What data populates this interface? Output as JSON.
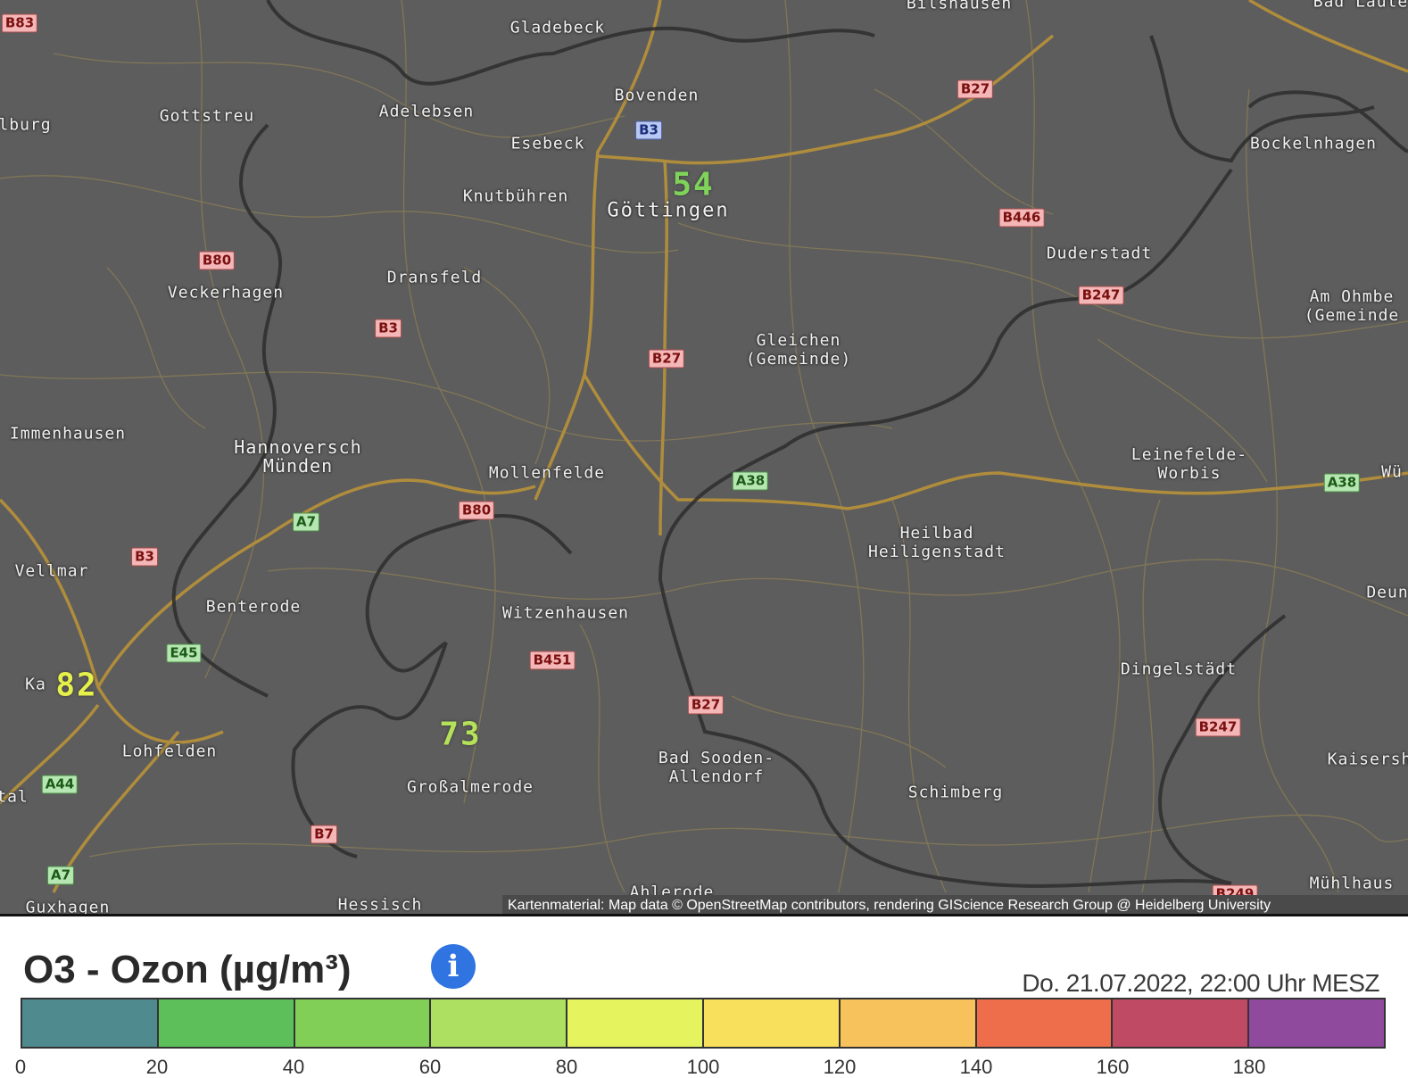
{
  "map": {
    "places": [
      {
        "id": "gladebeck",
        "name": "Gladebeck"
      },
      {
        "id": "bilshausen",
        "name": "Bilshausen"
      },
      {
        "id": "bad-lauter",
        "name": "Bad Laute"
      },
      {
        "id": "bovenden",
        "name": "Bovenden"
      },
      {
        "id": "burg",
        "name": "lburg"
      },
      {
        "id": "gottstreu",
        "name": "Gottstreu"
      },
      {
        "id": "adelebsen",
        "name": "Adelebsen"
      },
      {
        "id": "esebeck",
        "name": "Esebeck"
      },
      {
        "id": "bockelnhagen",
        "name": "Bockelnhagen"
      },
      {
        "id": "knutbuehren",
        "name": "Knutbühren"
      },
      {
        "id": "goettingen",
        "name": "Göttingen"
      },
      {
        "id": "duderstadt",
        "name": "Duderstadt"
      },
      {
        "id": "veckerhagen",
        "name": "Veckerhagen"
      },
      {
        "id": "dransfeld",
        "name": "Dransfeld"
      },
      {
        "id": "am-ohmberg",
        "name": "Am Ohmbe\n(Gemeinde"
      },
      {
        "id": "gleichen",
        "name": "Gleichen\n(Gemeinde)"
      },
      {
        "id": "immenhausen",
        "name": "Immenhausen"
      },
      {
        "id": "hann-muenden",
        "name": "Hannoversch\nMünden"
      },
      {
        "id": "leinefelde",
        "name": "Leinefelde-\nWorbis"
      },
      {
        "id": "wue",
        "name": "Wü"
      },
      {
        "id": "mollenfelde",
        "name": "Mollenfelde"
      },
      {
        "id": "heilbad",
        "name": "Heilbad\nHeiligenstadt"
      },
      {
        "id": "vellmar",
        "name": "Vellmar"
      },
      {
        "id": "deun",
        "name": "Deun"
      },
      {
        "id": "benterode",
        "name": "Benterode"
      },
      {
        "id": "witzenhausen",
        "name": "Witzenhausen"
      },
      {
        "id": "dingelstaedt",
        "name": "Dingelstädt"
      },
      {
        "id": "kassel",
        "name": "Ka"
      },
      {
        "id": "lohfelden",
        "name": "Lohfelden"
      },
      {
        "id": "bad-sooden",
        "name": "Bad Sooden-\nAllendorf"
      },
      {
        "id": "kaisers",
        "name": "Kaisersh"
      },
      {
        "id": "tal",
        "name": "tal"
      },
      {
        "id": "grossalmerode",
        "name": "Großalmerode"
      },
      {
        "id": "schimberg",
        "name": "Schimberg"
      },
      {
        "id": "ahlerode",
        "name": "Ahlerode"
      },
      {
        "id": "muehlhausen",
        "name": "Mühlhaus"
      },
      {
        "id": "guxhagen",
        "name": "Guxhagen"
      },
      {
        "id": "hessisch",
        "name": "Hessisch"
      }
    ],
    "roads": [
      {
        "id": "b83",
        "label": "B83",
        "type": "b"
      },
      {
        "id": "b27-n",
        "label": "B27",
        "type": "b"
      },
      {
        "id": "b3-goe",
        "label": "B3",
        "type": "bl"
      },
      {
        "id": "b446",
        "label": "B446",
        "type": "b"
      },
      {
        "id": "b80-n",
        "label": "B80",
        "type": "b"
      },
      {
        "id": "b247-n",
        "label": "B247",
        "type": "b"
      },
      {
        "id": "b3-w",
        "label": "B3",
        "type": "b"
      },
      {
        "id": "b27-m",
        "label": "B27",
        "type": "b"
      },
      {
        "id": "a38-m",
        "label": "A38",
        "type": "a"
      },
      {
        "id": "a38-e",
        "label": "A38",
        "type": "a"
      },
      {
        "id": "a7-n",
        "label": "A7",
        "type": "a"
      },
      {
        "id": "b80-s",
        "label": "B80",
        "type": "b"
      },
      {
        "id": "b3-sw",
        "label": "B3",
        "type": "b"
      },
      {
        "id": "e45",
        "label": "E45",
        "type": "a"
      },
      {
        "id": "b451",
        "label": "B451",
        "type": "b"
      },
      {
        "id": "b27-s",
        "label": "B27",
        "type": "b"
      },
      {
        "id": "b247-s",
        "label": "B247",
        "type": "b"
      },
      {
        "id": "a44",
        "label": "A44",
        "type": "a"
      },
      {
        "id": "b7",
        "label": "B7",
        "type": "b"
      },
      {
        "id": "a7-s",
        "label": "A7",
        "type": "a"
      },
      {
        "id": "b249",
        "label": "B249",
        "type": "b"
      }
    ],
    "measurements": [
      {
        "id": "goettingen",
        "value": "54",
        "color": "#7fd35a"
      },
      {
        "id": "kassel",
        "value": "82",
        "color": "#e6f04a"
      },
      {
        "id": "grossalmerode",
        "value": "73",
        "color": "#b4e05a"
      }
    ],
    "attribution": "Kartenmaterial: Map data © OpenStreetMap contributors, rendering GIScience Research Group @ Heidelberg University"
  },
  "legend": {
    "title": "O3 - Ozon (µg/m³)",
    "info_icon": "info-icon",
    "timestamp": "Do. 21.07.2022, 22:00 Uhr MESZ",
    "colors": [
      "#4f8a8f",
      "#5cbf5a",
      "#82cf58",
      "#ade060",
      "#e5f35f",
      "#f9e05c",
      "#f7c15b",
      "#ee6e4b",
      "#bf4a64",
      "#8f4a9e"
    ],
    "ticks": [
      "0",
      "20",
      "40",
      "60",
      "80",
      "100",
      "120",
      "140",
      "160",
      "180"
    ]
  }
}
